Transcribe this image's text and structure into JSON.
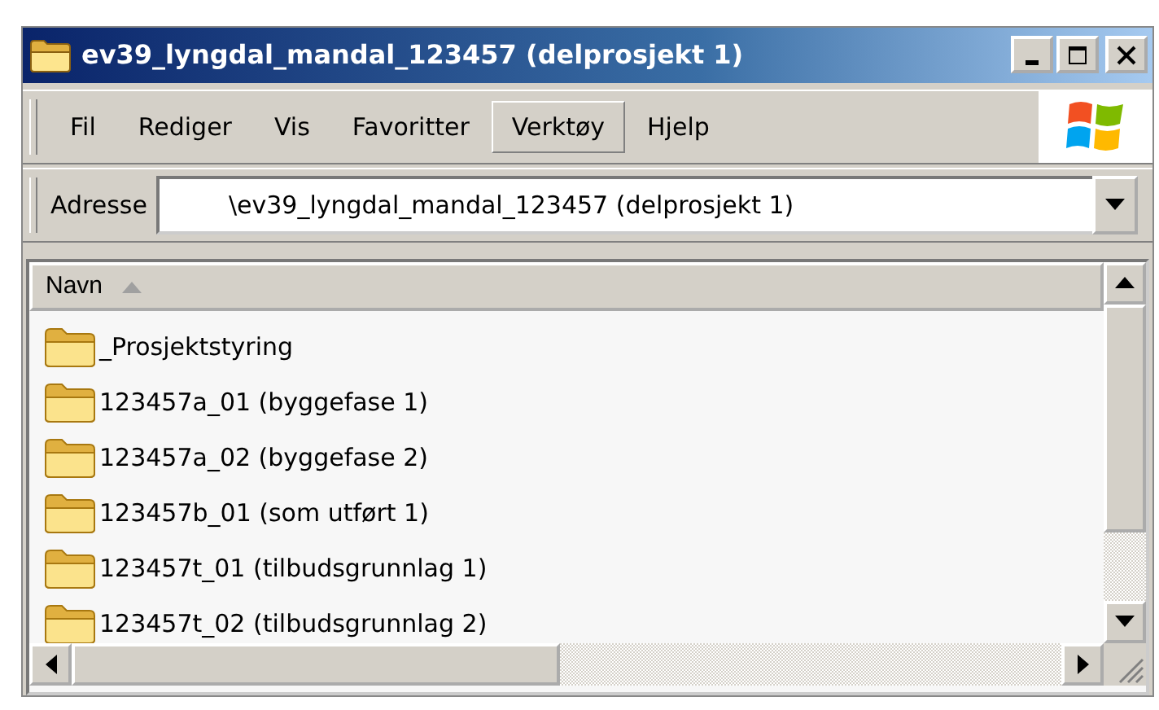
{
  "window": {
    "title": "ev39_lyngdal_mandal_123457 (delprosjekt 1)"
  },
  "menu": [
    {
      "label": "Fil",
      "highlighted": false
    },
    {
      "label": "Rediger",
      "highlighted": false
    },
    {
      "label": "Vis",
      "highlighted": false
    },
    {
      "label": "Favoritter",
      "highlighted": false
    },
    {
      "label": "Verktøy",
      "highlighted": true
    },
    {
      "label": "Hjelp",
      "highlighted": false
    }
  ],
  "address_bar": {
    "label": "Adresse",
    "value": "\\ev39_lyngdal_mandal_123457 (delprosjekt 1)"
  },
  "file_list": {
    "columns": [
      {
        "label": "Navn",
        "sort_ascending": true
      }
    ],
    "rows": [
      {
        "name": "_Prosjektstyring"
      },
      {
        "name": "123457a_01 (byggefase 1)"
      },
      {
        "name": "123457a_02 (byggefase 2)"
      },
      {
        "name": "123457b_01 (som utført 1)"
      },
      {
        "name": "123457t_01 (tilbudsgrunnlag 1)"
      },
      {
        "name": "123457t_02 (tilbudsgrunnlag 2)"
      }
    ]
  }
}
